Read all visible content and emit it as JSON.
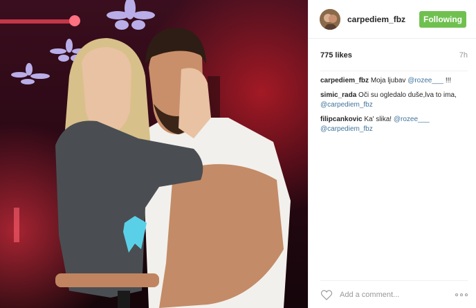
{
  "post": {
    "photo_alt": "Couple embracing in a nightclub",
    "header": {
      "username": "carpediem_fbz",
      "follow_label": "Following"
    },
    "likes": "775 likes",
    "time": "7h",
    "comments": [
      {
        "user": "carpediem_fbz",
        "text": "Moja ljubav",
        "mentions": [
          "@rozee___"
        ],
        "suffix": "!!!"
      },
      {
        "user": "simic_rada",
        "text": "Oči su ogledalo duše,lva to ima,",
        "mentions": [
          "@carpediem_fbz"
        ],
        "suffix": ""
      },
      {
        "user": "filipcankovic",
        "text": "Ka' slika!",
        "mentions": [
          "@rozee___",
          "@carpediem_fbz"
        ],
        "suffix": ""
      }
    ],
    "footer": {
      "add_comment_placeholder": "Add a comment..."
    },
    "colors": {
      "follow_button": "#70c050",
      "mention": "#3f729b",
      "muted": "#999999"
    },
    "icons": {
      "like": "heart-outline-icon",
      "more": "more-options-icon"
    }
  }
}
